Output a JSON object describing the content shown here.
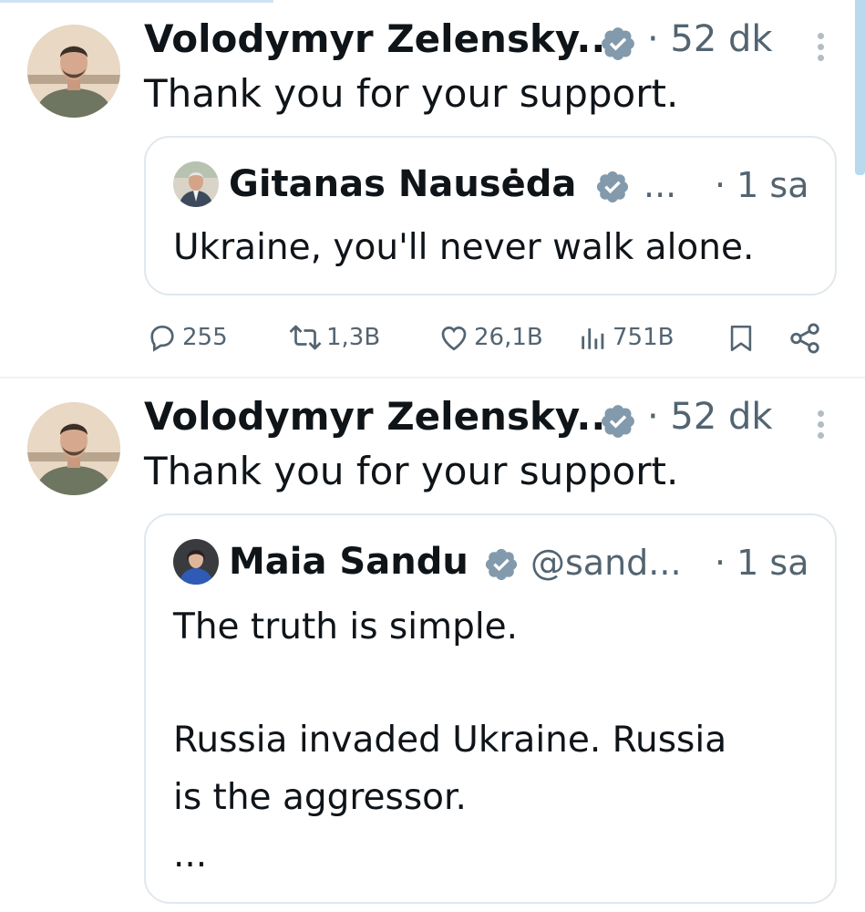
{
  "tweets": [
    {
      "author": "Volodymyr Zelensky...",
      "time": "· 52 dk",
      "text": "Thank you for your support.",
      "quote": {
        "author": "Gitanas Nausėda",
        "handle": "...",
        "time": "· 1 sa",
        "lines": [
          "Ukraine, you'll never walk alone."
        ]
      },
      "actions": {
        "replies": "255",
        "retweets": "1,3B",
        "likes": "26,1B",
        "views": "751B"
      }
    },
    {
      "author": "Volodymyr Zelensky...",
      "time": "· 52 dk",
      "text": "Thank you for your support.",
      "quote": {
        "author": "Maia Sandu",
        "handle": "@sand...",
        "time": "· 1 sa",
        "lines": [
          "The truth is simple.",
          "Russia invaded Ukraine. Russia",
          "is the aggressor.",
          "..."
        ]
      }
    }
  ],
  "colors": {
    "text": "#0f1419",
    "muted": "#536471",
    "verified": "#829aab",
    "border": "#e1e8ed"
  },
  "icons": [
    "verified-badge-icon",
    "more-vertical-icon",
    "reply-icon",
    "retweet-icon",
    "like-icon",
    "views-icon",
    "bookmark-icon",
    "share-icon"
  ]
}
